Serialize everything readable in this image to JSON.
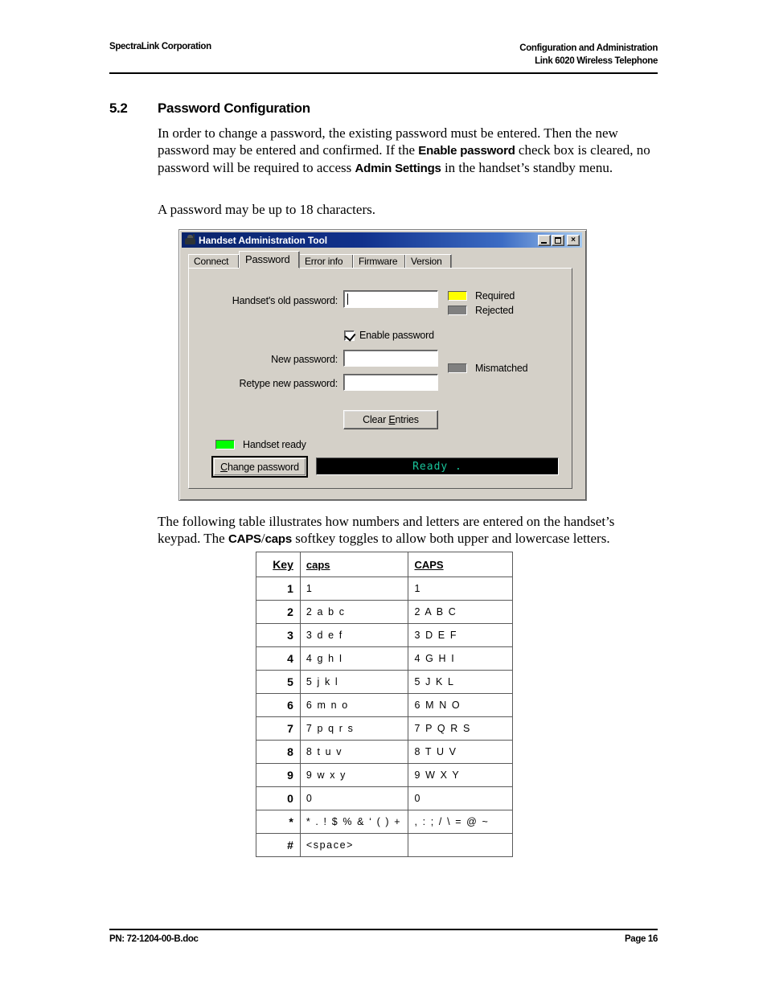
{
  "header": {
    "left": "SpectraLink Corporation",
    "right_line1": "Configuration and Administration",
    "right_line2": "Link 6020 Wireless Telephone"
  },
  "section": {
    "number": "5.2",
    "title": "Password Configuration"
  },
  "paragraphs": {
    "intro_part1": "In order to change a password, the existing password must be entered. Then the new password may be entered and confirmed. If the ",
    "intro_bold1": "Enable password",
    "intro_part2": " check box is cleared, no password will be required to access ",
    "intro_bold2": "Admin Settings",
    "intro_part3": " in the handset’s standby menu.",
    "length": "A password may be up to 18 characters.",
    "table_note_part1": "The following table illustrates how numbers and letters are entered on the handset’s keypad. The ",
    "table_note_bold1": "CAPS",
    "table_note_slash": "/",
    "table_note_bold2": "caps",
    "table_note_part2": " softkey toggles to allow both upper and lowercase letters."
  },
  "dialog": {
    "title": "Handset Administration Tool",
    "icon": "handset-icon",
    "window_buttons": {
      "minimize": "minimize-icon",
      "maximize": "maximize-icon",
      "close": "×"
    },
    "tabs": [
      {
        "label": "Connect",
        "active": false
      },
      {
        "label": "Password",
        "active": true
      },
      {
        "label": "Error info",
        "active": false
      },
      {
        "label": "Firmware",
        "active": false
      },
      {
        "label": "Version",
        "active": false
      }
    ],
    "fields": [
      {
        "label": "Handset's old password:",
        "value": ""
      },
      {
        "label": "New password:",
        "value": ""
      },
      {
        "label": "Retype new password:",
        "value": ""
      }
    ],
    "checkbox": {
      "label": "Enable password",
      "checked": true
    },
    "legend": [
      {
        "label": "Required",
        "color": "#ffff00"
      },
      {
        "label": "Rejected",
        "color": "#808080"
      },
      {
        "label": "Mismatched",
        "color": "#808080"
      }
    ],
    "buttons": {
      "clear_entries_pre": "Clear ",
      "clear_entries_acc": "E",
      "clear_entries_post": "ntries",
      "change_password_acc": "C",
      "change_password_post": "hange password"
    },
    "handset_status": {
      "label": "Handset ready",
      "led_color": "#00ff00"
    },
    "status_display": {
      "text": "Ready .",
      "text_color": "#19c49a",
      "background": "#000000"
    }
  },
  "keypad_table": {
    "columns": [
      "Key",
      "caps",
      "CAPS"
    ],
    "rows": [
      {
        "key": "1",
        "caps": "1",
        "CAPS": "1"
      },
      {
        "key": "2",
        "caps": "2 a b c",
        "CAPS": "2 A B C"
      },
      {
        "key": "3",
        "caps": "3 d e f",
        "CAPS": "3 D E F"
      },
      {
        "key": "4",
        "caps": "4 g h I",
        "CAPS": "4 G H I"
      },
      {
        "key": "5",
        "caps": "5 j k l",
        "CAPS": "5 J K L"
      },
      {
        "key": "6",
        "caps": "6 m n o",
        "CAPS": "6 M N O"
      },
      {
        "key": "7",
        "caps": "7 p q r s",
        "CAPS": "7 P Q R S"
      },
      {
        "key": "8",
        "caps": "8 t u v",
        "CAPS": "8 T U V"
      },
      {
        "key": "9",
        "caps": "9 w x y",
        "CAPS": "9 W X Y"
      },
      {
        "key": "0",
        "caps": "0",
        "CAPS": "0"
      },
      {
        "key": "*",
        "caps": "* . ! $ % & ‘ ( ) +",
        "CAPS": ", : ; / \\ = @ ~"
      },
      {
        "key": "#",
        "caps": "<space>",
        "CAPS": ""
      }
    ]
  },
  "footer": {
    "left": "PN: 72-1204-00-B.doc",
    "right": "Page 16"
  }
}
